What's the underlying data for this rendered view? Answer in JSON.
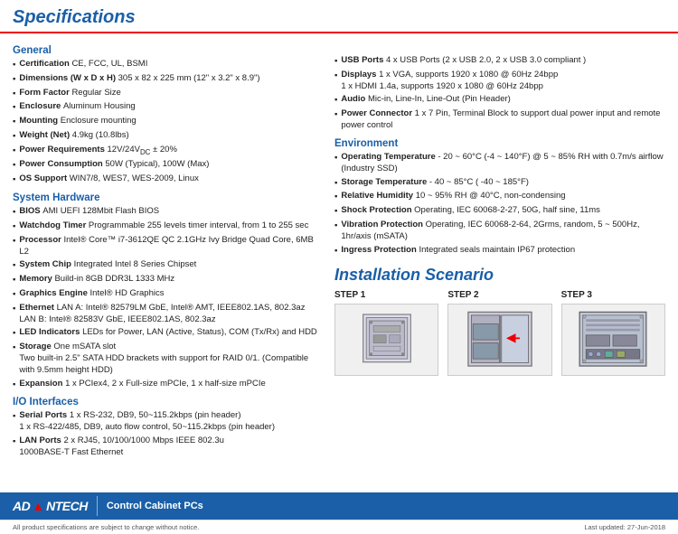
{
  "header": {
    "title": "Specifications"
  },
  "left": {
    "sections": [
      {
        "title": "General",
        "items": [
          {
            "key": "Certification",
            "value": "CE, FCC, UL, BSMI"
          },
          {
            "key": "Dimensions (W x D x H)",
            "value": "305 x 82 x 225 mm (12\" x 3.2\" x 8.9\")"
          },
          {
            "key": "Form Factor",
            "value": "Regular Size"
          },
          {
            "key": "Enclosure",
            "value": "Aluminum Housing"
          },
          {
            "key": "Mounting",
            "value": "Enclosure mounting"
          },
          {
            "key": "Weight (Net)",
            "value": "4.9kg (10.8lbs)"
          },
          {
            "key": "Power Requirements",
            "value": "12V/24VDC ± 20%"
          },
          {
            "key": "Power Consumption",
            "value": "50W (Typical), 100W (Max)"
          },
          {
            "key": "OS Support",
            "value": "WIN7/8, WES7, WES-2009, Linux"
          }
        ]
      },
      {
        "title": "System Hardware",
        "items": [
          {
            "key": "BIOS",
            "value": "AMI UEFI 128Mbit Flash BIOS"
          },
          {
            "key": "Watchdog Timer",
            "value": "Programmable 255 levels timer interval, from 1 to 255 sec"
          },
          {
            "key": "Processor",
            "value": "Intel® Core™ i7-3612QE QC 2.1GHz Ivy Bridge Quad Core, 6MB L2"
          },
          {
            "key": "System Chip",
            "value": "Integrated Intel 8 Series Chipset"
          },
          {
            "key": "Memory",
            "value": "Build-in 8GB DDR3L 1333 MHz"
          },
          {
            "key": "Graphics Engine",
            "value": "Intel® HD Graphics"
          },
          {
            "key": "Ethernet",
            "value": "LAN A: Intel® 82579LM GbE, Intel® AMT, IEEE802.1AS, 802.3az\nLAN B: Intel® 82583V GbE, IEEE802.1AS, 802.3az"
          },
          {
            "key": "LED Indicators",
            "value": "LEDs for Power, LAN (Active, Status), COM (Tx/Rx) and HDD"
          },
          {
            "key": "Storage",
            "value": "One mSATA slot\nTwo built-in 2.5\" SATA HDD brackets with support for RAID 0/1. (Compatible with 9.5mm height HDD)"
          },
          {
            "key": "Expansion",
            "value": "1 x PCIex4, 2 x Full-size mPCIe, 1 x half-size mPCIe"
          }
        ]
      },
      {
        "title": "I/O Interfaces",
        "items": [
          {
            "key": "Serial Ports",
            "value": "1 x RS-232, DB9, 50~115.2kbps (pin header)\n1 x RS-422/485, DB9, auto flow control, 50~115.2kbps (pin header)"
          },
          {
            "key": "LAN Ports",
            "value": "2 x RJ45, 10/100/1000 Mbps IEEE 802.3u\n1000BASE-T Fast Ethernet"
          }
        ]
      }
    ]
  },
  "right": {
    "io_items": [
      {
        "key": "USB Ports",
        "value": "4 x USB Ports (2 x USB 2.0, 2 x USB 3.0 compliant )"
      },
      {
        "key": "Displays",
        "value": "1 x VGA, supports 1920 x 1080 @ 60Hz 24bpp\n1 x HDMI 1.4a, supports 1920 x 1080 @ 60Hz 24bpp"
      },
      {
        "key": "Audio",
        "value": "Mic-in, Line-In, Line-Out (Pin Header)"
      },
      {
        "key": "Power Connector",
        "value": "1 x 7 Pin, Terminal Block to support dual power input and remote power control"
      }
    ],
    "env_title": "Environment",
    "env_items": [
      {
        "key": "Operating Temperature",
        "value": "- 20 ~ 60°C (-4 ~ 140°F) @ 5 ~ 85% RH with 0.7m/s airflow (Industry SSD)"
      },
      {
        "key": "Storage Temperature",
        "value": "- 40 ~ 85°C ( -40 ~ 185°F)"
      },
      {
        "key": "Relative Humidity",
        "value": "10 ~ 95% RH @ 40°C, non-condensing"
      },
      {
        "key": "Shock Protection",
        "value": "Operating, IEC 60068-2-27, 50G, half sine, 11ms"
      },
      {
        "key": "Vibration Protection",
        "value": "Operating, IEC 60068-2-64, 2Grms, random, 5 ~ 500Hz, 1hr/axis (mSATA)"
      },
      {
        "key": "Ingress Protection",
        "value": "Integrated seals maintain IP67 protection"
      }
    ],
    "install_title": "Installation Scenario",
    "steps": [
      {
        "label": "STEP 1"
      },
      {
        "label": "STEP 2"
      },
      {
        "label": "STEP 3"
      }
    ]
  },
  "footer": {
    "logo": "AD▲NTECH",
    "logo_adv": "AD",
    "logo_v": "▲",
    "logo_ntech": "NTECH",
    "tagline": "Control Cabinet PCs",
    "notice_left": "All product specifications are subject to change without notice.",
    "notice_right": "Last updated: 27-Jun-2018"
  }
}
